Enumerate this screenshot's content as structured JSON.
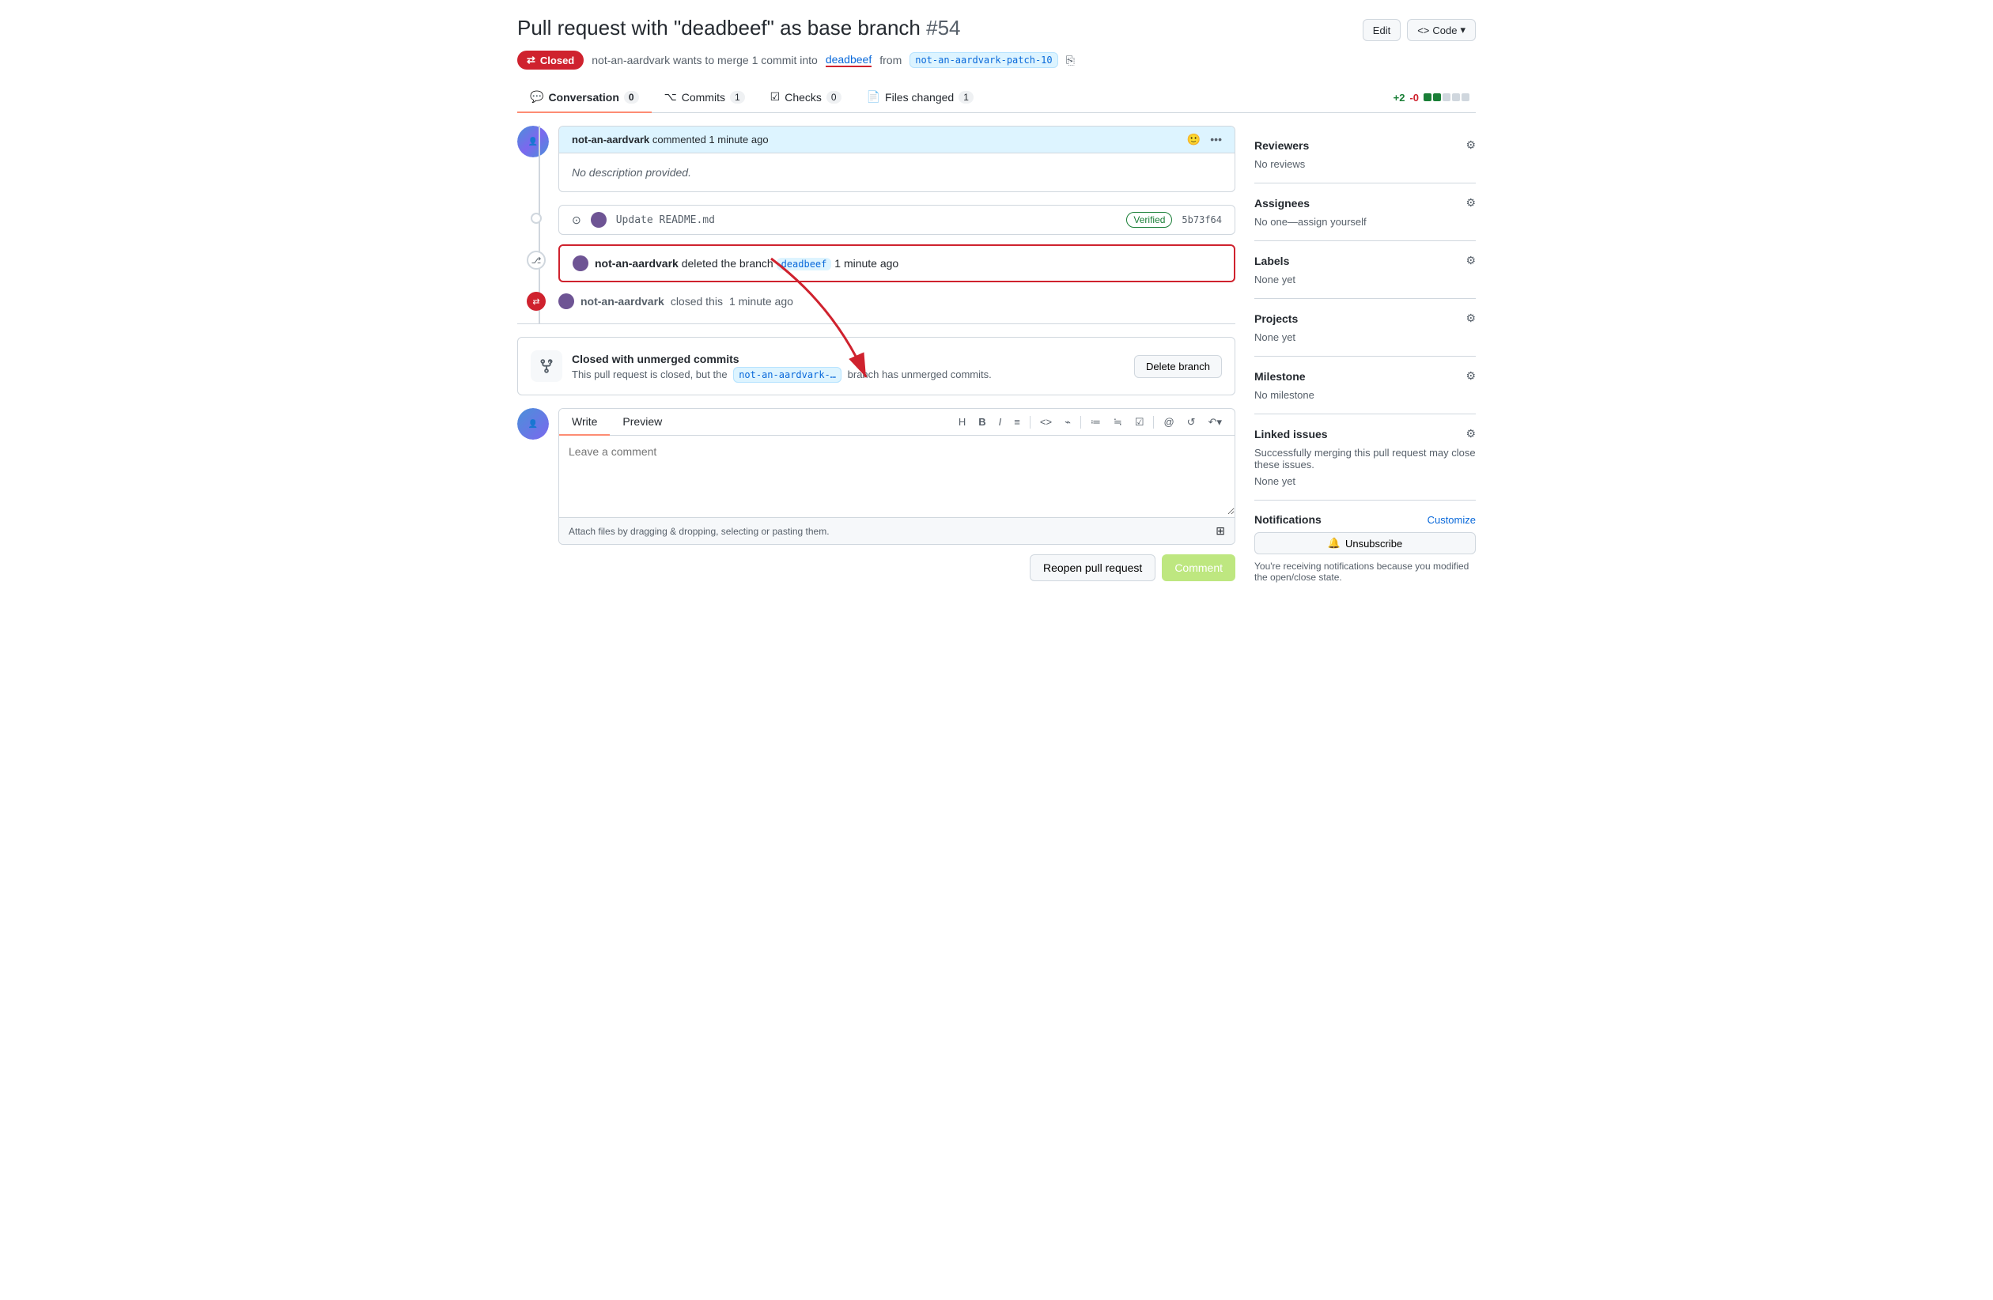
{
  "page": {
    "title": "Pull request with \"deadbeef\" as base branch",
    "pr_number": "#54",
    "header_buttons": {
      "edit": "Edit",
      "code": "Code"
    }
  },
  "status": {
    "badge_text": "Closed",
    "description": "not-an-aardvark wants to merge 1 commit into",
    "base_branch": "deadbeef",
    "from_text": "from",
    "head_branch": "not-an-aardvark-patch-10"
  },
  "tabs": [
    {
      "id": "conversation",
      "label": "Conversation",
      "count": "0",
      "active": true
    },
    {
      "id": "commits",
      "label": "Commits",
      "count": "1",
      "active": false
    },
    {
      "id": "checks",
      "label": "Checks",
      "count": "0",
      "active": false
    },
    {
      "id": "files_changed",
      "label": "Files changed",
      "count": "1",
      "active": false
    }
  ],
  "diff_stats": {
    "add": "+2",
    "del": "-0",
    "bars": [
      2,
      3
    ]
  },
  "comment": {
    "author": "not-an-aardvark",
    "time": "commented 1 minute ago",
    "body": "No description provided."
  },
  "commit_item": {
    "label": "Update README.md",
    "badge": "Verified",
    "hash": "5b73f64"
  },
  "delete_branch_event": {
    "author": "not-an-aardvark",
    "action": "deleted the branch",
    "branch": "deadbeef",
    "time": "1 minute ago"
  },
  "closed_event": {
    "author": "not-an-aardvark",
    "action": "closed this",
    "time": "1 minute ago"
  },
  "unmerged_box": {
    "title": "Closed with unmerged commits",
    "description": "This pull request is closed, but the",
    "branch": "not-an-aardvark-…",
    "description2": "branch has unmerged commits.",
    "button": "Delete branch"
  },
  "editor": {
    "tab_write": "Write",
    "tab_preview": "Preview",
    "placeholder": "Leave a comment",
    "footer_text": "Attach files by dragging & dropping, selecting or pasting them.",
    "toolbar": [
      "H",
      "B",
      "I",
      "≡",
      "<>",
      "⌁",
      "≔",
      "≒",
      "☑",
      "@",
      "↺",
      "↶"
    ]
  },
  "actions": {
    "reopen": "Reopen pull request",
    "comment": "Comment"
  },
  "sidebar": {
    "reviewers": {
      "title": "Reviewers",
      "value": "No reviews"
    },
    "assignees": {
      "title": "Assignees",
      "value": "No one—assign yourself"
    },
    "labels": {
      "title": "Labels",
      "value": "None yet"
    },
    "projects": {
      "title": "Projects",
      "value": "None yet"
    },
    "milestone": {
      "title": "Milestone",
      "value": "No milestone"
    },
    "linked_issues": {
      "title": "Linked issues",
      "description": "Successfully merging this pull request may close these issues.",
      "value": "None yet"
    },
    "notifications": {
      "title": "Notifications",
      "customize": "Customize",
      "button": "Unsubscribe",
      "note": "You're receiving notifications because you modified the open/close state."
    }
  }
}
